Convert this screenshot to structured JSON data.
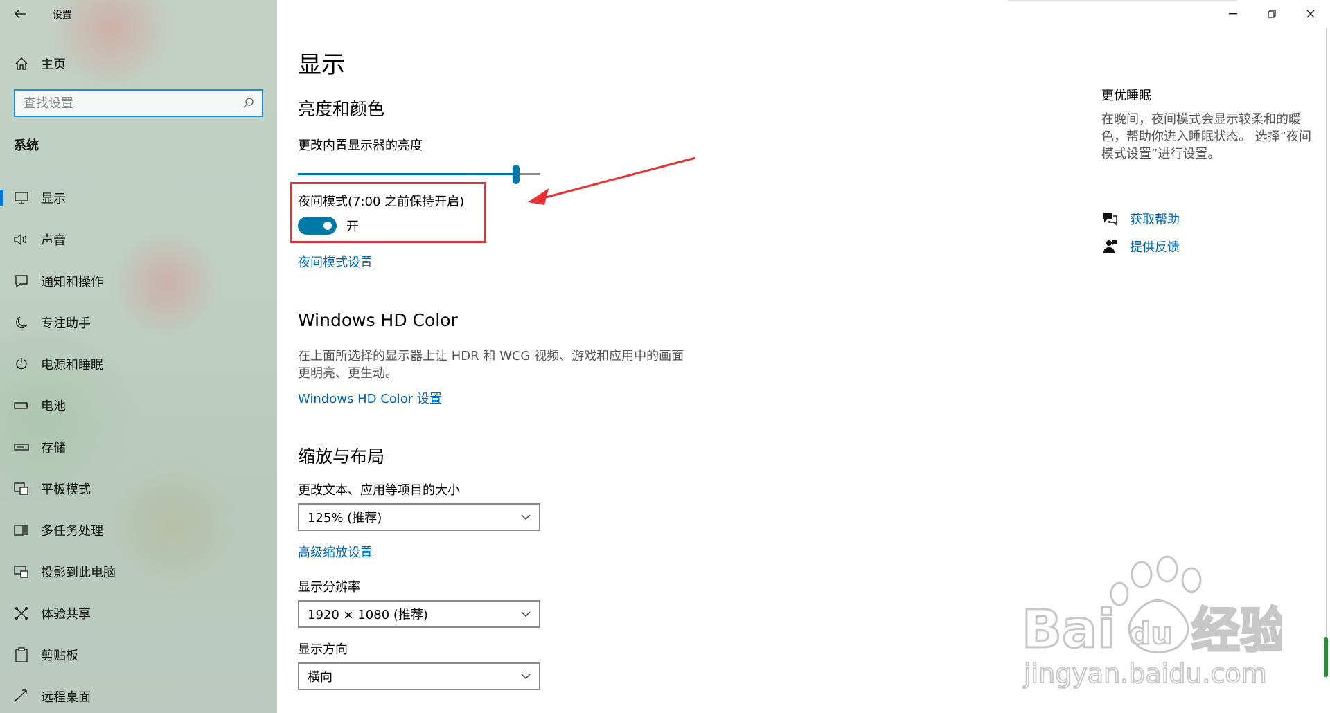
{
  "window": {
    "title": "设置"
  },
  "sidebar": {
    "home_label": "主页",
    "search_placeholder": "查找设置",
    "section_label": "系统",
    "items": [
      {
        "label": "显示",
        "icon": "monitor-icon",
        "selected": true
      },
      {
        "label": "声音",
        "icon": "speaker-icon"
      },
      {
        "label": "通知和操作",
        "icon": "notification-icon"
      },
      {
        "label": "专注助手",
        "icon": "moon-icon"
      },
      {
        "label": "电源和睡眠",
        "icon": "power-icon"
      },
      {
        "label": "电池",
        "icon": "battery-icon"
      },
      {
        "label": "存储",
        "icon": "storage-icon"
      },
      {
        "label": "平板模式",
        "icon": "tablet-mode-icon"
      },
      {
        "label": "多任务处理",
        "icon": "multitasking-icon"
      },
      {
        "label": "投影到此电脑",
        "icon": "project-icon"
      },
      {
        "label": "体验共享",
        "icon": "share-icon"
      },
      {
        "label": "剪贴板",
        "icon": "clipboard-icon"
      },
      {
        "label": "远程桌面",
        "icon": "remote-desktop-icon"
      }
    ]
  },
  "main": {
    "title": "显示",
    "brightness_section": {
      "heading": "亮度和颜色",
      "slider_label": "更改内置显示器的亮度",
      "brightness_fraction": 0.9,
      "night_light_label": "夜间模式(7:00 之前保持开启)",
      "night_light_state": "开",
      "night_light_settings_link": "夜间模式设置"
    },
    "hdr_section": {
      "heading": "Windows HD Color",
      "description": "在上面所选择的显示器上让 HDR 和 WCG 视频、游戏和应用中的画面更明亮、更生动。",
      "link": "Windows HD Color 设置"
    },
    "scale_section": {
      "heading": "缩放与布局",
      "scale_label": "更改文本、应用等项目的大小",
      "scale_value": "125% (推荐)",
      "advanced_link": "高级缩放设置",
      "resolution_label": "显示分辨率",
      "resolution_value": "1920 × 1080 (推荐)",
      "orientation_label": "显示方向",
      "orientation_value": "横向"
    }
  },
  "side_panel": {
    "title": "更优睡眠",
    "description": "在晚间，夜间模式会显示较柔和的暖色，帮助你进入睡眠状态。 选择“夜间模式设置”进行设置。",
    "help_link": "获取帮助",
    "feedback_link": "提供反馈"
  },
  "colors": {
    "accent": "#0078a8",
    "link": "#0067b8",
    "highlight": "#e53333"
  }
}
